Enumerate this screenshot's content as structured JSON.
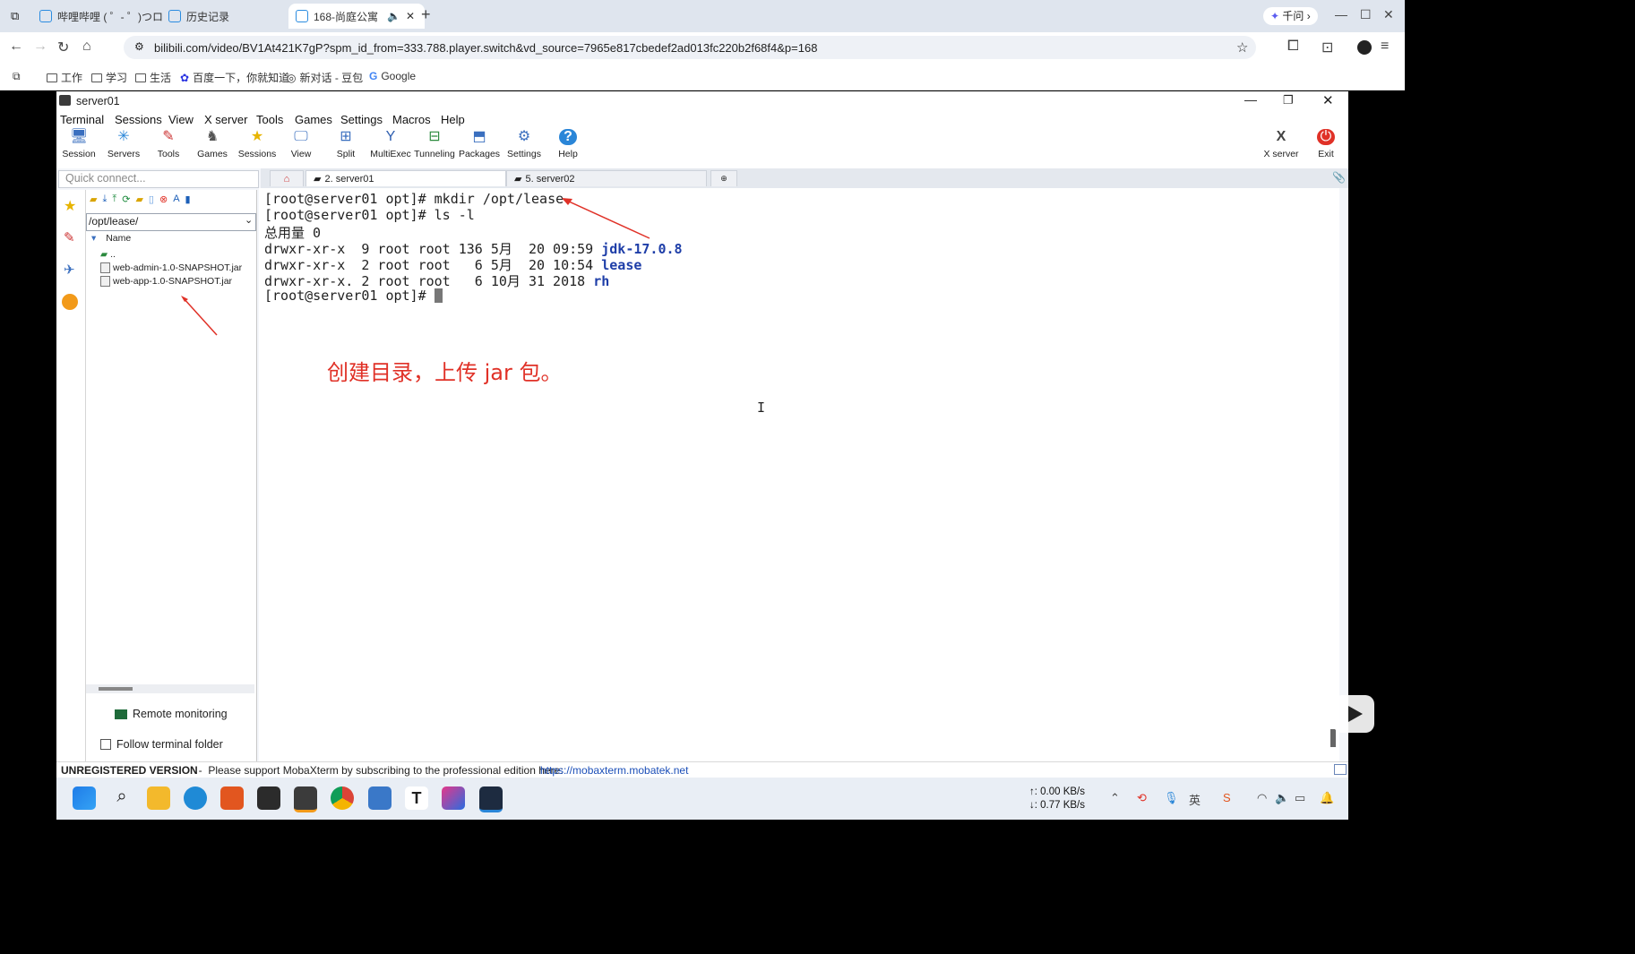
{
  "browser": {
    "tabs": [
      {
        "label": "哔哩哔哩 ( ゜- ゜)つロ"
      },
      {
        "label": "历史记录"
      },
      {
        "label": "168-尚庭公寓"
      }
    ],
    "assistant_label": "千问",
    "url": "bilibili.com/video/BV1At421K7gP?spm_id_from=333.788.player.switch&vd_source=7965e817cbedef2ad013fc220b2f68f4&p=168",
    "bookmarks": [
      "工作",
      "学习",
      "生活",
      "百度一下，你就知道",
      "新对话 - 豆包",
      "Google"
    ]
  },
  "moba": {
    "title": "server01",
    "menu": [
      "Terminal",
      "Sessions",
      "View",
      "X server",
      "Tools",
      "Games",
      "Settings",
      "Macros",
      "Help"
    ],
    "ribbon": [
      "Session",
      "Servers",
      "Tools",
      "Games",
      "Sessions",
      "View",
      "Split",
      "MultiExec",
      "Tunneling",
      "Packages",
      "Settings",
      "Help"
    ],
    "ribbon_right": [
      "X server",
      "Exit"
    ],
    "quick_connect_placeholder": "Quick connect...",
    "tabs": [
      {
        "label": "2. server01"
      },
      {
        "label": "5. server02"
      }
    ],
    "sidebar": {
      "path": "/opt/lease/",
      "column_name": "Name",
      "parent": "..",
      "files": [
        "web-admin-1.0-SNAPSHOT.jar",
        "web-app-1.0-SNAPSHOT.jar"
      ],
      "remote_monitoring": "Remote monitoring",
      "follow_terminal": "Follow terminal folder"
    },
    "terminal": {
      "lines": [
        "[root@server01 opt]# mkdir /opt/lease",
        "[root@server01 opt]# ls -l",
        "总用量 0"
      ],
      "rows": [
        {
          "perm": "drwxr-xr-x  9 root root 136 5月  20 09:59 ",
          "name": "jdk-17.0.8"
        },
        {
          "perm": "drwxr-xr-x  2 root root   6 5月  20 10:54 ",
          "name": "lease"
        },
        {
          "perm": "drwxr-xr-x. 2 root root   6 10月 31 2018 ",
          "name": "rh"
        }
      ],
      "prompt": "[root@server01 opt]# "
    },
    "annotation": "创建目录，上传 jar 包。",
    "status": {
      "unregistered": "UNREGISTERED VERSION",
      "message": "  -  Please support MobaXterm by subscribing to the professional edition here:",
      "link": "https://mobaxterm.mobatek.net"
    }
  },
  "taskbar": {
    "upload": "↑: 0.00 KB/s",
    "download": "↓: 0.77 KB/s"
  }
}
